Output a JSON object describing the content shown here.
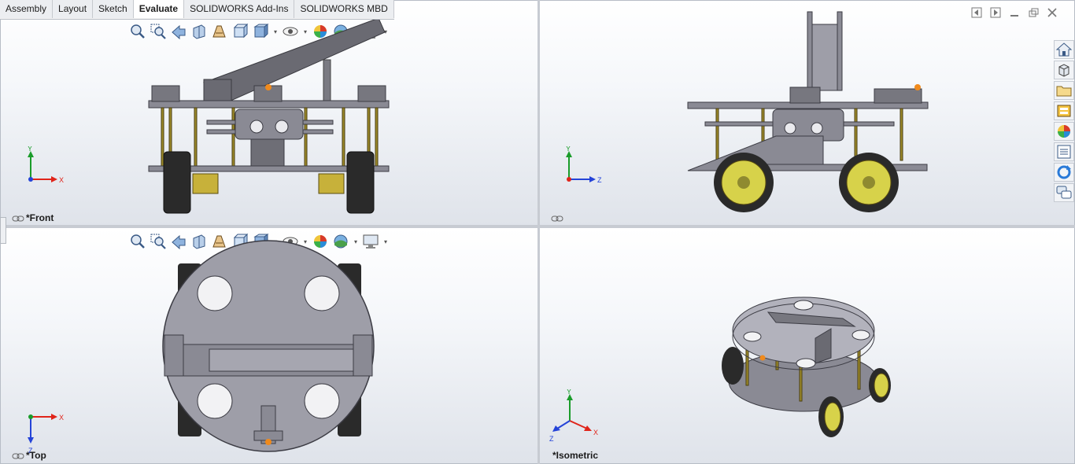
{
  "tabs": [
    {
      "label": "Assembly"
    },
    {
      "label": "Layout"
    },
    {
      "label": "Sketch"
    },
    {
      "label": "Evaluate",
      "active": true
    },
    {
      "label": "SOLIDWORKS Add-Ins"
    },
    {
      "label": "SOLIDWORKS MBD"
    }
  ],
  "viewports": {
    "front": {
      "label": "*Front",
      "axes": {
        "up": "Y",
        "right": "X"
      }
    },
    "right": {
      "label": "",
      "axes": {
        "up": "Y",
        "right": "Z"
      }
    },
    "top": {
      "label": "*Top",
      "axes": {
        "right": "X",
        "down": "Z"
      }
    },
    "iso": {
      "label": "*Isometric",
      "axes": {
        "up": "Y",
        "left": "Z",
        "right": "X"
      }
    }
  },
  "toolbar_icons": [
    "zoom-to-fit-icon",
    "zoom-to-area-icon",
    "previous-view-icon",
    "section-view-icon",
    "dynamic-annotation-icon",
    "view-orientation-icon",
    "display-style-icon",
    "hide-show-icon",
    "edit-appearance-icon",
    "apply-scene-icon",
    "view-settings-icon"
  ],
  "task_pane_icons": [
    "home-icon",
    "3d-parts-icon",
    "file-explorer-icon",
    "design-library-icon",
    "appearances-icon",
    "custom-properties-icon",
    "update-icon",
    "forum-icon"
  ],
  "colors": {
    "plate": "#9e9ea8",
    "plate_dark": "#56565e",
    "wheel": "#d7d24a",
    "tire": "#2a2a2a",
    "accent": "#f08a1c",
    "axis_x": "#e0241a",
    "axis_y": "#1a9c2a",
    "axis_z": "#2443d8"
  }
}
